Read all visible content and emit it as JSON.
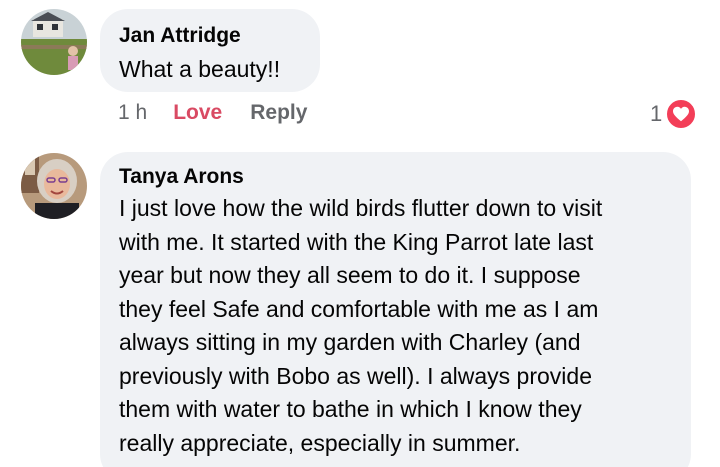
{
  "comments": [
    {
      "author": "Jan Attridge",
      "text": "What a beauty!!",
      "time": "1 h",
      "love_label": "Love",
      "reply_label": "Reply",
      "reaction_count": "1",
      "reaction_icon": "heart-icon",
      "reaction_color": "#f33e58"
    },
    {
      "author": "Tanya Arons",
      "text_lines": [
        "I just love how the wild birds flutter down to visit",
        "with me.  It started with the King Parrot late last",
        "year but now they all seem to do it. I suppose",
        "they feel Safe and comfortable with me as I am",
        "always sitting in my garden with Charley (and",
        "previously with Bobo as well).  I always provide",
        "them with water to bathe in which I know they",
        "really appreciate, especially in summer."
      ]
    }
  ],
  "colors": {
    "bubble": "#f0f2f5",
    "love_active": "#d94a63",
    "secondary_text": "#65676b"
  }
}
